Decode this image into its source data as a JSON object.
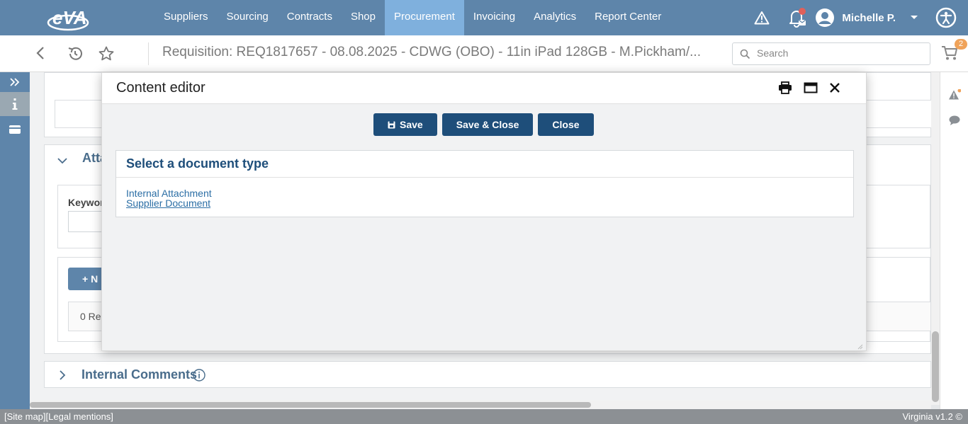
{
  "app": {
    "logo_text": "eVA"
  },
  "nav": {
    "items": [
      {
        "label": "Suppliers",
        "active": false
      },
      {
        "label": "Sourcing",
        "active": false
      },
      {
        "label": "Contracts",
        "active": false
      },
      {
        "label": "Shop",
        "active": false
      },
      {
        "label": "Procurement",
        "active": true
      },
      {
        "label": "Invoicing",
        "active": false
      },
      {
        "label": "Analytics",
        "active": false
      },
      {
        "label": "Report Center",
        "active": false
      }
    ],
    "user_name": "Michelle P."
  },
  "subbar": {
    "title": "Requisition: REQ1817657 - 08.08.2025 - CDWG (OBO) - 11in iPad 128GB - M.Pickham/...",
    "search_placeholder": "Search",
    "cart_count": "2"
  },
  "background": {
    "section_attachments": "Atta",
    "keyword_label": "Keywor",
    "new_button": "N",
    "records": "0 Re",
    "internal_comments": "Internal Comments"
  },
  "modal": {
    "title": "Content editor",
    "save_label": "Save",
    "save_close_label": "Save & Close",
    "close_label": "Close",
    "doc_type_title": "Select a document type",
    "doc_types": [
      "Internal Attachment",
      "Supplier Document"
    ]
  },
  "footer": {
    "site_map": "[Site map]",
    "legal": "[Legal mentions]",
    "version": "Virginia v1.2 ©"
  },
  "colors": {
    "nav_bg": "#5e85aa",
    "nav_active": "#7fb0dd",
    "primary_button": "#1e4e7a",
    "link": "#2b6ea5",
    "badge": "#f0a35a",
    "alert_dot": "#e0605a"
  }
}
